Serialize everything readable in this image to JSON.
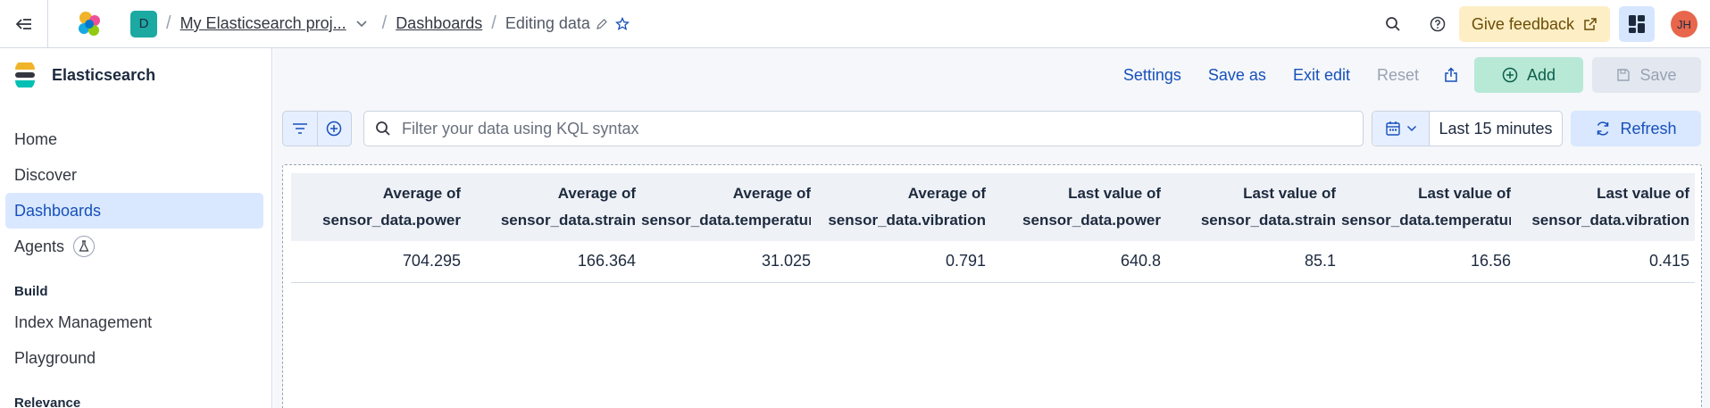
{
  "header": {
    "space_initial": "D",
    "breadcrumbs": [
      "My Elasticsearch proj...",
      "Dashboards",
      "Editing data"
    ],
    "feedback_label": "Give feedback",
    "user_initials": "JH"
  },
  "sidebar": {
    "title": "Elasticsearch",
    "items": [
      {
        "label": "Home"
      },
      {
        "label": "Discover"
      },
      {
        "label": "Dashboards"
      },
      {
        "label": "Agents"
      }
    ],
    "build_label": "Build",
    "build_items": [
      {
        "label": "Index Management"
      },
      {
        "label": "Playground"
      }
    ],
    "relevance_label": "Relevance"
  },
  "toolbar": {
    "settings_label": "Settings",
    "save_as_label": "Save as",
    "exit_edit_label": "Exit edit",
    "reset_label": "Reset",
    "add_label": "Add",
    "save_label": "Save"
  },
  "query": {
    "placeholder": "Filter your data using KQL syntax",
    "time_range": "Last 15 minutes",
    "refresh_label": "Refresh"
  },
  "table": {
    "columns": [
      {
        "l1": "Average of",
        "l2": "sensor_data.power"
      },
      {
        "l1": "Average of",
        "l2": "sensor_data.strain"
      },
      {
        "l1": "Average of",
        "l2": "sensor_data.temperature"
      },
      {
        "l1": "Average of",
        "l2": "sensor_data.vibration"
      },
      {
        "l1": "Last value of",
        "l2": "sensor_data.power"
      },
      {
        "l1": "Last value of",
        "l2": "sensor_data.strain"
      },
      {
        "l1": "Last value of",
        "l2": "sensor_data.temperature"
      },
      {
        "l1": "Last value of",
        "l2": "sensor_data.vibration"
      }
    ],
    "rows": [
      [
        "704.295",
        "166.364",
        "31.025",
        "0.791",
        "640.8",
        "85.1",
        "16.56",
        "0.415"
      ]
    ]
  },
  "colors": {
    "accent": "#1750ba",
    "active_nav_bg": "#d9e8ff",
    "feedback_bg": "#fdeec5",
    "add_bg": "#b8e8d6",
    "space_avatar": "#1ba9a2",
    "user_avatar": "#e7664c"
  }
}
